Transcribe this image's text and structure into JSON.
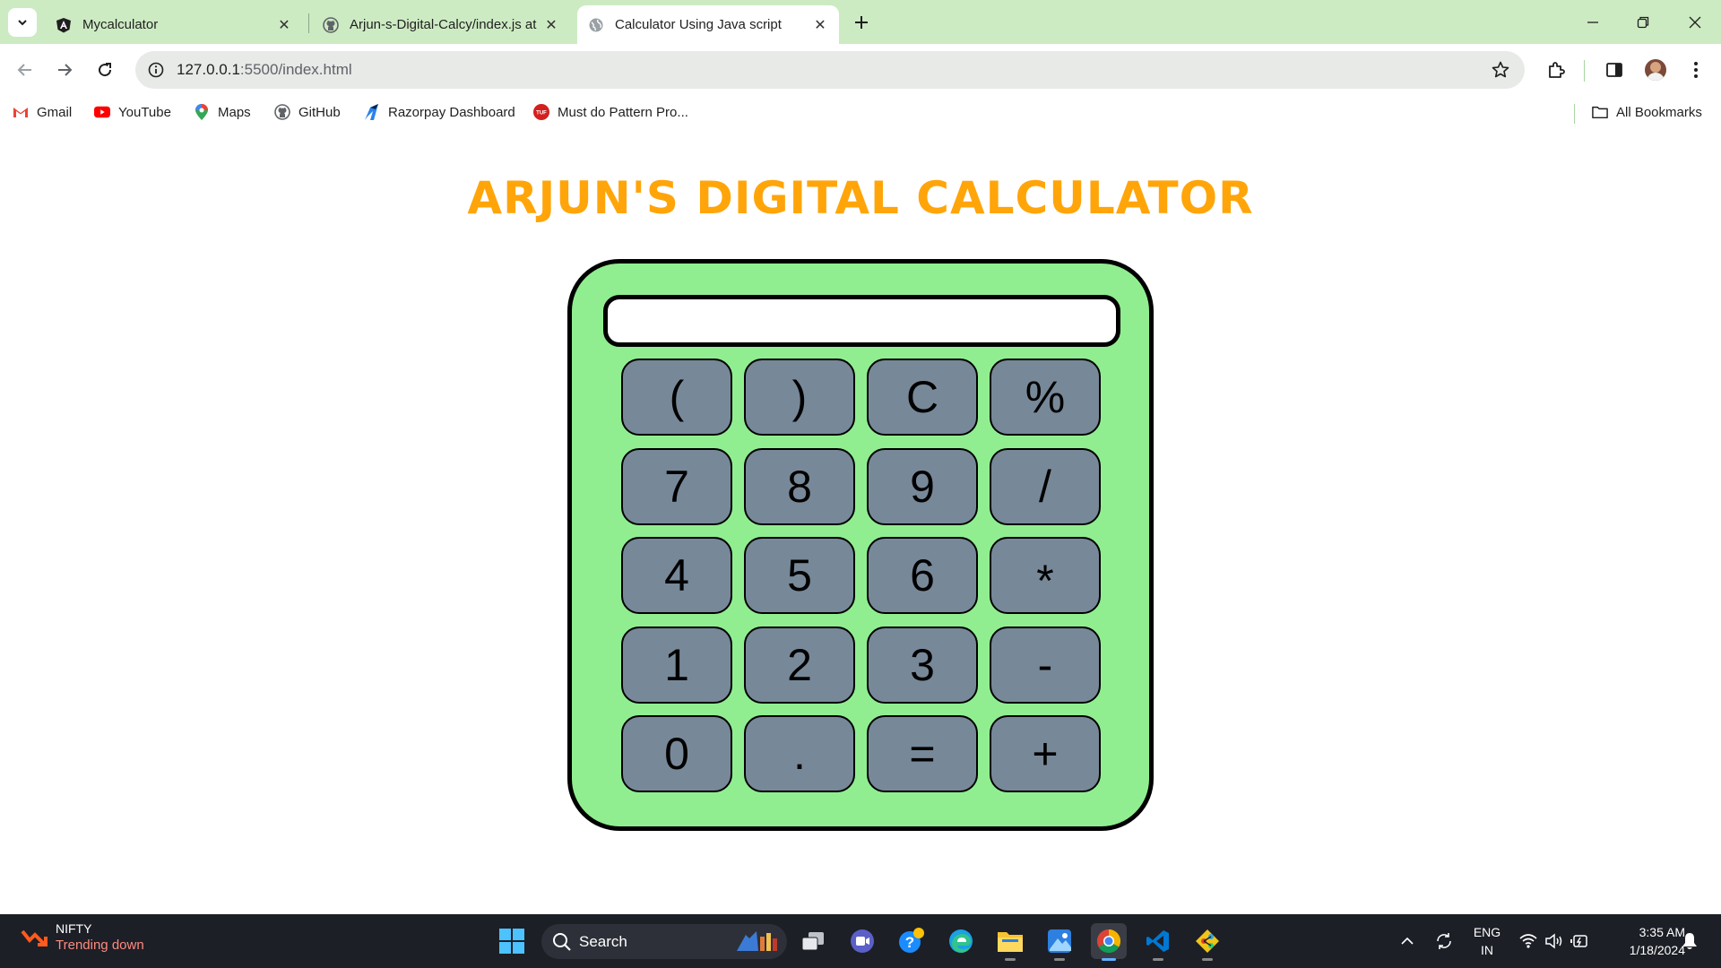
{
  "browser": {
    "tabs": [
      {
        "title": "Mycalculator",
        "icon": "angular-icon"
      },
      {
        "title": "Arjun-s-Digital-Calcy/index.js at",
        "icon": "github-icon"
      },
      {
        "title": "Calculator Using Java script",
        "icon": "globe-icon",
        "active": true
      }
    ],
    "url": {
      "host": "127.0.0.1",
      "rest": ":5500/index.html"
    },
    "bookmarks": [
      {
        "label": "Gmail",
        "icon": "gmail-icon"
      },
      {
        "label": "YouTube",
        "icon": "youtube-icon"
      },
      {
        "label": "Maps",
        "icon": "maps-icon"
      },
      {
        "label": "GitHub",
        "icon": "github-icon"
      },
      {
        "label": "Razorpay Dashboard",
        "icon": "razorpay-icon"
      },
      {
        "label": "Must do Pattern Pro...",
        "icon": "tuf-icon"
      }
    ],
    "all_bookmarks": "All Bookmarks"
  },
  "page": {
    "title": "ARJUN'S DIGITAL CALCULATOR",
    "display_value": "",
    "keys": [
      [
        "(",
        ")",
        "C",
        "%"
      ],
      [
        "7",
        "8",
        "9",
        "/"
      ],
      [
        "4",
        "5",
        "6",
        "*"
      ],
      [
        "1",
        "2",
        "3",
        "-"
      ],
      [
        "0",
        ".",
        "=",
        "+"
      ]
    ],
    "colors": {
      "title": "#ffa50a",
      "body": "#90ee90",
      "key": "#778899"
    }
  },
  "taskbar": {
    "widget_title": "NIFTY",
    "widget_sub": "Trending down",
    "search_label": "Search",
    "lang_top": "ENG",
    "lang_bottom": "IN",
    "time": "3:35 AM",
    "date": "1/18/2024"
  }
}
